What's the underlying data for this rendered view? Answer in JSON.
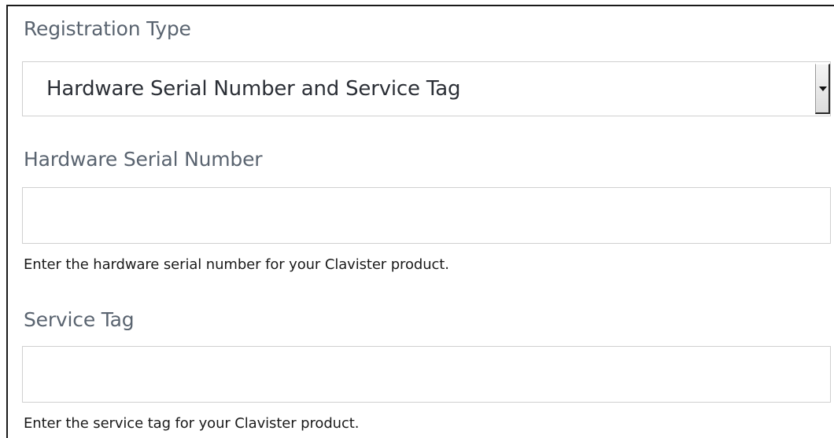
{
  "registration_type": {
    "label": "Registration Type",
    "selected_value": "Hardware Serial Number and Service Tag"
  },
  "hardware_serial_number": {
    "label": "Hardware Serial Number",
    "value": "",
    "help_text": "Enter the hardware serial number for your Clavister product."
  },
  "service_tag": {
    "label": "Service Tag",
    "value": "",
    "help_text": "Enter the service tag for your Clavister product."
  },
  "icons": {
    "dropdown_arrow": "chevron-down-icon"
  },
  "colors": {
    "label_text": "#5a6470",
    "value_text": "#2b2f36",
    "help_text": "#1a1a1a",
    "field_border": "#d0d0d0"
  }
}
